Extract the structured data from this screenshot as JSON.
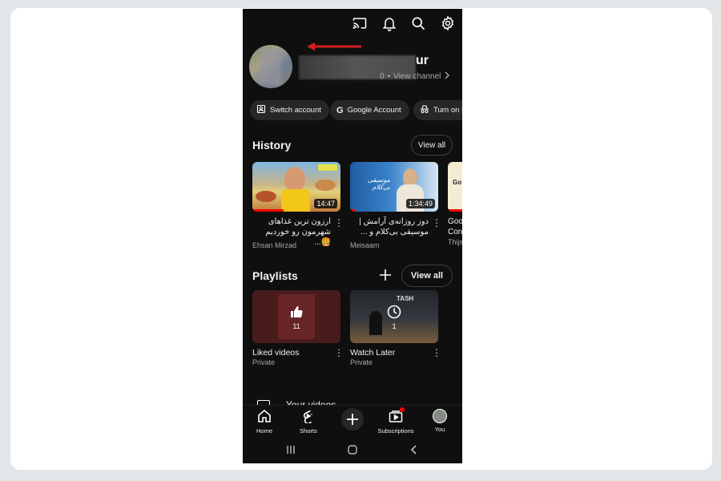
{
  "colors": {
    "background": "#0f0f0f",
    "chip": "#272727",
    "accent_red": "#ff0000",
    "text_secondary": "#aaaaaa"
  },
  "topbar": {
    "icons": [
      "cast-icon",
      "bell-icon",
      "search-icon",
      "gear-icon"
    ]
  },
  "profile": {
    "name_visible": "ur",
    "handle_visible": "0",
    "separator": "•",
    "view_channel": "View channel"
  },
  "chips": [
    {
      "label": "Switch account",
      "icon": "switch-account-icon"
    },
    {
      "label": "Google Account",
      "icon": "google-icon"
    },
    {
      "label": "Turn on In",
      "icon": "incognito-icon"
    }
  ],
  "history": {
    "title": "History",
    "view_all": "View all",
    "videos": [
      {
        "title": "ارزون ترین غذاهای شهرمون رو خوردیم🍔...",
        "channel": "Ehsan Mirzad",
        "duration": "14:47",
        "progress": 0.35
      },
      {
        "title": "دوز روزانه‌ی آرامش | موسیقی بی‌کلام و ...",
        "channel": "Meisaam",
        "duration": "1:34:49",
        "progress": 0.05,
        "thumb_text": "موسیقی بی‌کلام"
      },
      {
        "title": "Goo Con",
        "channel": "Thijs",
        "thumb_text": "Go E"
      }
    ]
  },
  "playlists": {
    "title": "Playlists",
    "view_all": "View all",
    "items": [
      {
        "title": "Liked videos",
        "privacy": "Private",
        "count": "11"
      },
      {
        "title": "Watch Later",
        "privacy": "Private",
        "count": "1",
        "thumb_text": "TASH"
      }
    ]
  },
  "your_videos": "Your videos",
  "nav": [
    {
      "label": "Home",
      "icon": "home-icon"
    },
    {
      "label": "Shorts",
      "icon": "shorts-icon"
    },
    {
      "label": "",
      "icon": "create-plus-icon"
    },
    {
      "label": "Subscriptions",
      "icon": "subscriptions-icon"
    },
    {
      "label": "You",
      "icon": "you-avatar-icon"
    }
  ]
}
